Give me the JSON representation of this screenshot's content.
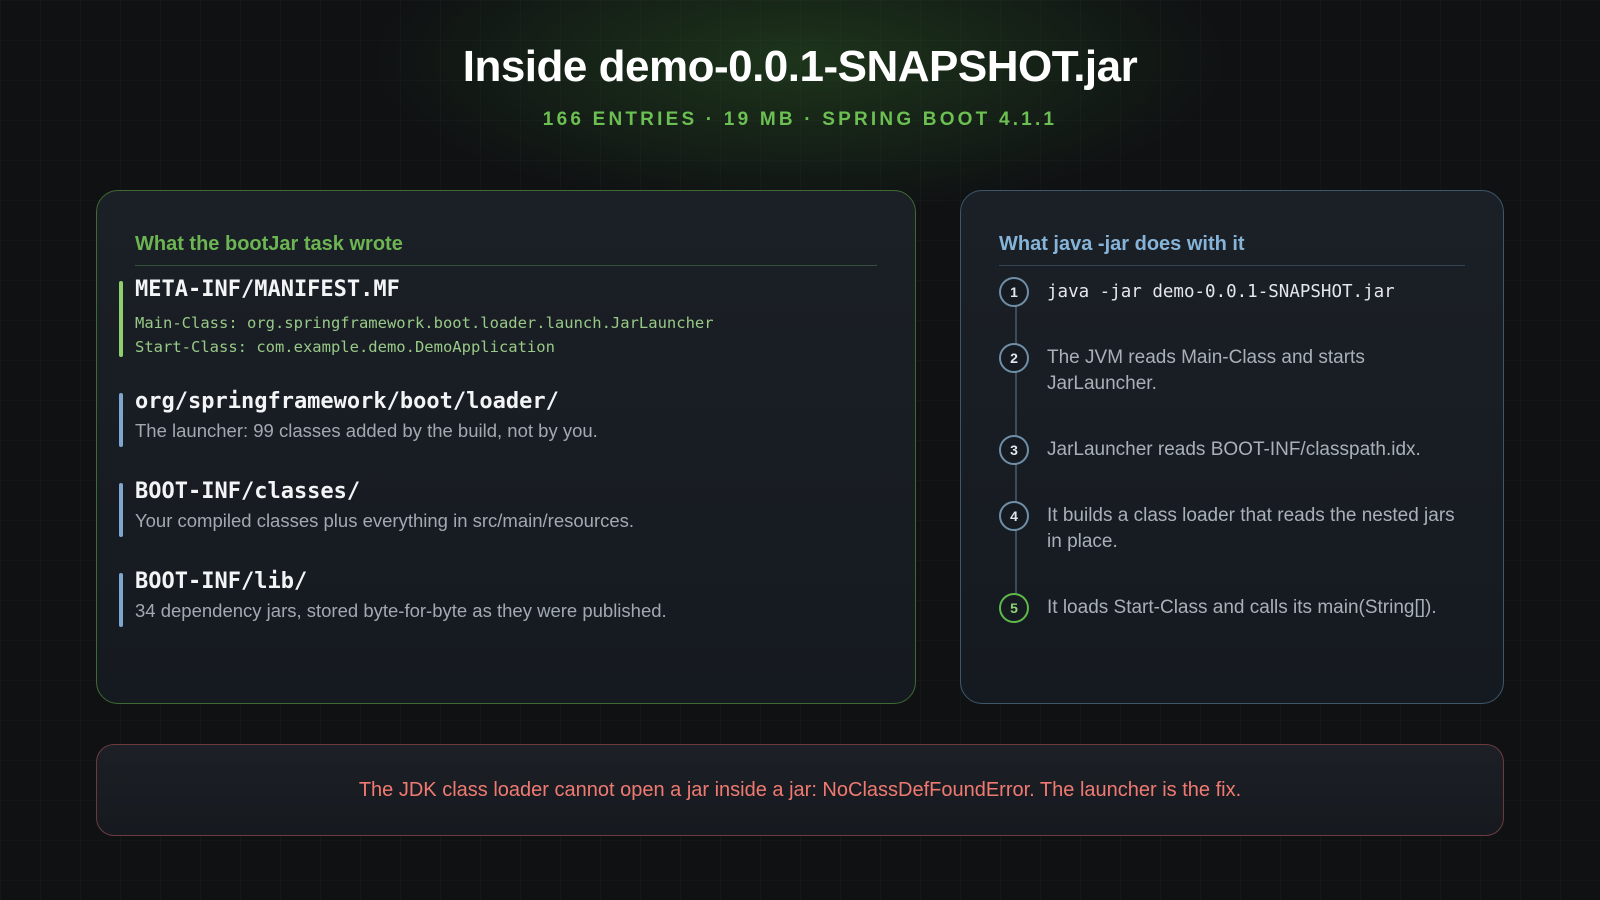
{
  "header": {
    "title": "Inside demo-0.0.1-SNAPSHOT.jar",
    "subtitle": "166 ENTRIES · 19 MB · SPRING BOOT 4.1.1"
  },
  "left_panel": {
    "heading": "What the bootJar task wrote",
    "entries": [
      {
        "path": "META-INF/MANIFEST.MF",
        "code": [
          "Main-Class: org.springframework.boot.loader.launch.JarLauncher",
          "Start-Class: com.example.demo.DemoApplication"
        ]
      },
      {
        "path": "org/springframework/boot/loader/",
        "desc": "The launcher: 99 classes added by the build, not by you."
      },
      {
        "path": "BOOT-INF/classes/",
        "desc": "Your compiled classes plus everything in src/main/resources."
      },
      {
        "path": "BOOT-INF/lib/",
        "desc": "34 dependency jars, stored byte-for-byte as they were published."
      }
    ]
  },
  "right_panel": {
    "heading": "What java -jar does with it",
    "steps": [
      {
        "num": "1",
        "text": "java -jar demo-0.0.1-SNAPSHOT.jar"
      },
      {
        "num": "2",
        "text": "The JVM reads Main-Class and starts JarLauncher."
      },
      {
        "num": "3",
        "text": "JarLauncher reads BOOT-INF/classpath.idx."
      },
      {
        "num": "4",
        "text": "It builds a class loader that reads the nested jars in place."
      },
      {
        "num": "5",
        "text": "It loads Start-Class and calls its main(String[])."
      }
    ]
  },
  "callout": {
    "text": "The JDK class loader cannot open a jar inside a jar: NoClassDefFoundError. The launcher is the fix."
  },
  "colors": {
    "accent_green": "#6cb552",
    "accent_blue": "#86b4d9",
    "accent_red": "#f07a72",
    "manifest_bar": "#8fcf6e",
    "entry_bar": "#7ea7cf"
  }
}
